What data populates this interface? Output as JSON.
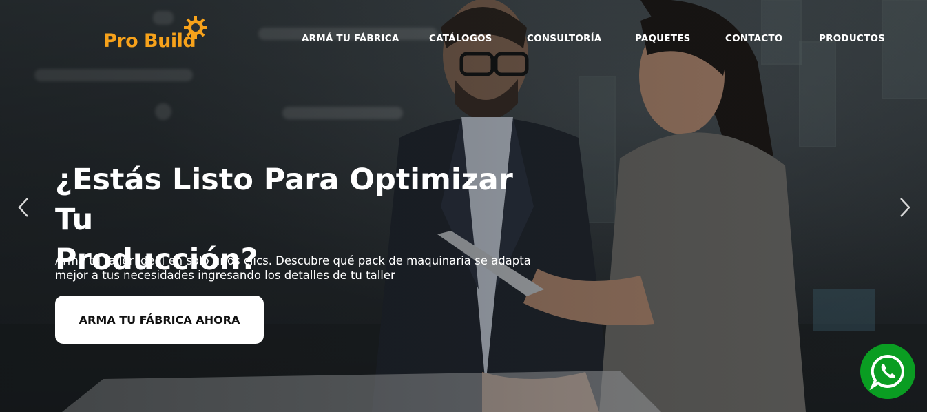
{
  "brand": {
    "name": "Pro Build",
    "color": "#f7a21b"
  },
  "nav": {
    "items": [
      {
        "label": "ARMÁ TU FÁBRICA"
      },
      {
        "label": "CATÁLOGOS"
      },
      {
        "label": "CONSULTORÍA"
      },
      {
        "label": "PAQUETES"
      },
      {
        "label": "CONTACTO"
      },
      {
        "label": "PRODUCTOS"
      }
    ]
  },
  "hero": {
    "headline_line1": "¿Estás Listo Para Optimizar Tu",
    "headline_line2": "Producción?",
    "subtext_line1": "Arma tu taller ideal en solo unos clics. Descubre qué pack de maquinaria se adapta",
    "subtext_line2": "mejor a tus necesidades ingresando los detalles de tu taller",
    "cta_label": "ARMA TU FÁBRICA AHORA"
  },
  "carousel": {
    "prev_icon": "chevron-left-icon",
    "next_icon": "chevron-right-icon"
  },
  "floating": {
    "whatsapp_icon": "whatsapp-icon",
    "whatsapp_color": "#0a9d22"
  }
}
